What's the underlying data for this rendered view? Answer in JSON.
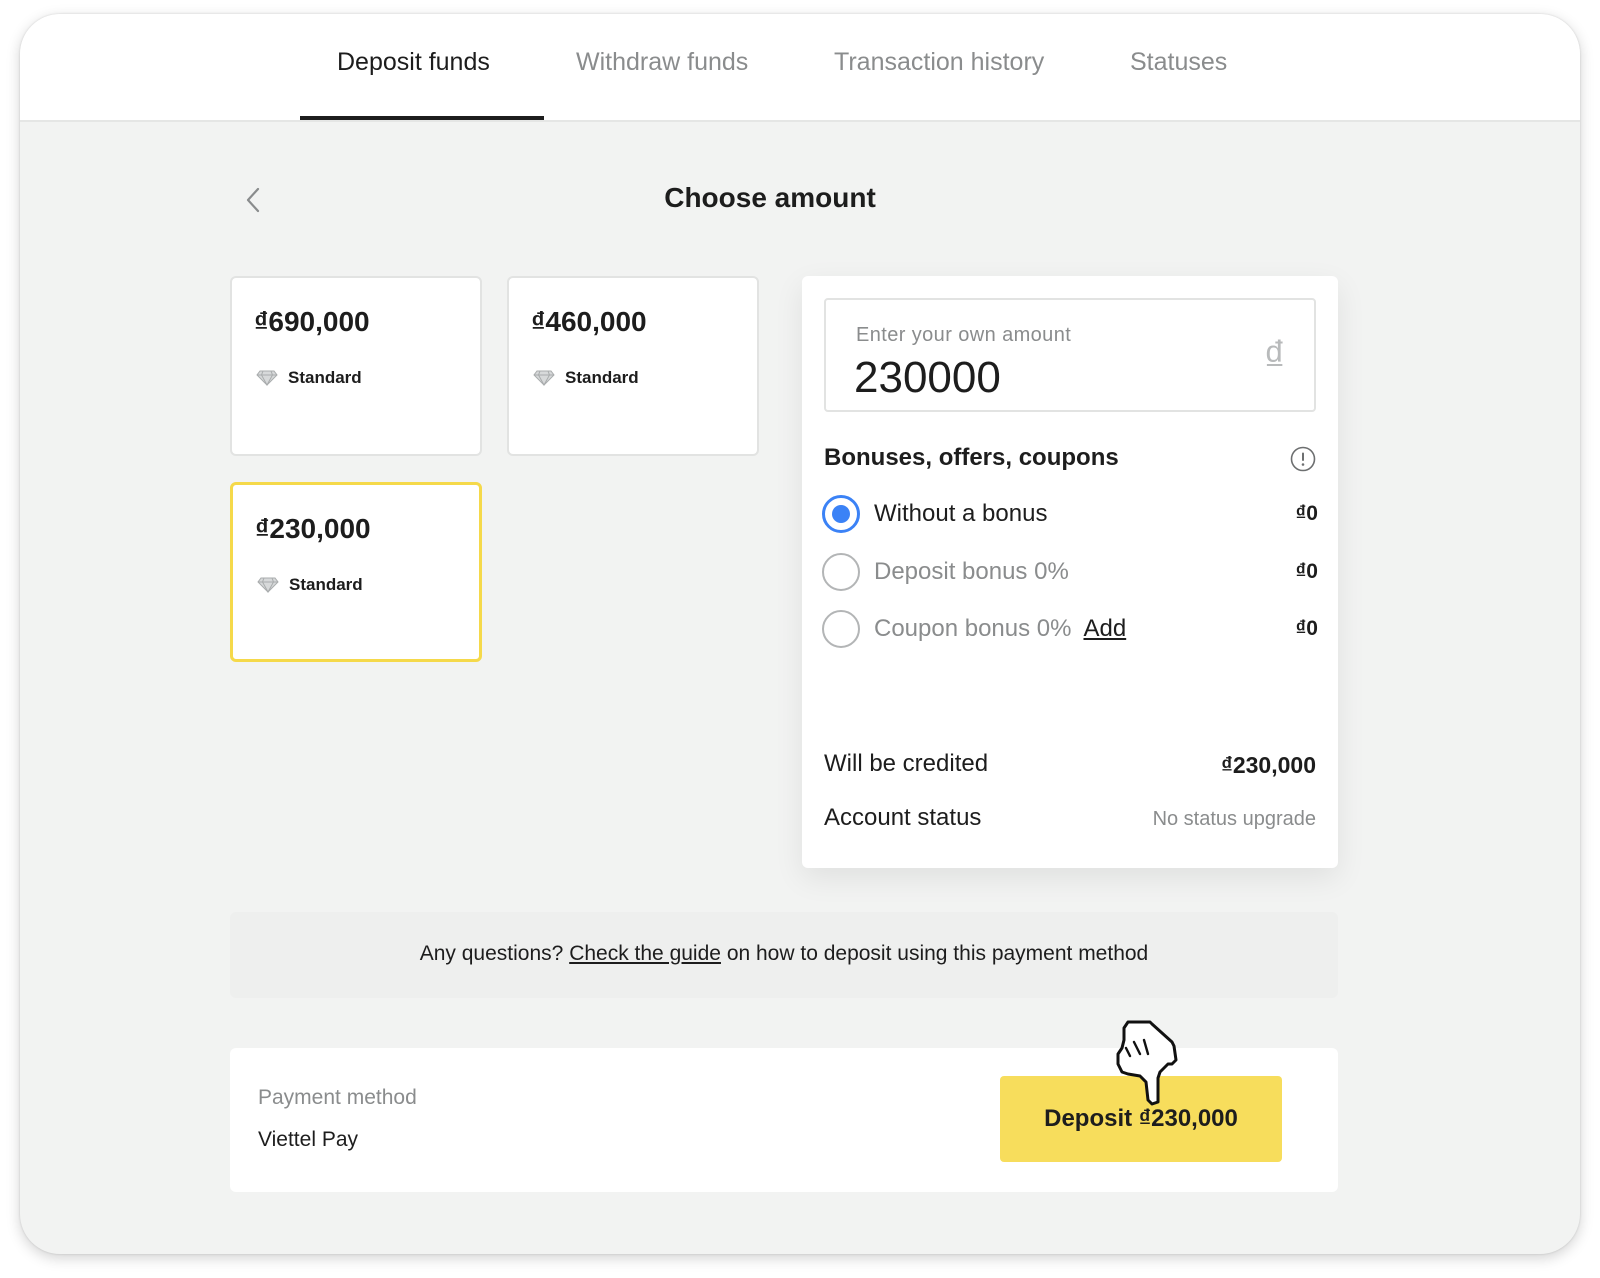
{
  "tabs": [
    {
      "label": "Deposit funds",
      "active": true
    },
    {
      "label": "Withdraw funds",
      "active": false
    },
    {
      "label": "Transaction history",
      "active": false
    },
    {
      "label": "Statuses",
      "active": false
    }
  ],
  "header": {
    "title": "Choose amount",
    "back_icon": "chevron-left-icon"
  },
  "amount_cards": [
    {
      "amount": "₫690,000",
      "tier": "Standard",
      "selected": false
    },
    {
      "amount": "₫460,000",
      "tier": "Standard",
      "selected": false
    },
    {
      "amount": "₫230,000",
      "tier": "Standard",
      "selected": true
    }
  ],
  "own_amount": {
    "label": "Enter your own amount",
    "value": "230000",
    "currency_symbol": "₫"
  },
  "bonuses": {
    "title": "Bonuses, offers, coupons",
    "info_icon": "info-icon",
    "options": [
      {
        "label": "Without a bonus",
        "value": "₫0",
        "selected": true
      },
      {
        "label": "Deposit bonus 0%",
        "value": "₫0",
        "selected": false
      },
      {
        "label": "Coupon bonus 0%",
        "value": "₫0",
        "selected": false,
        "link": "Add"
      }
    ]
  },
  "summary": {
    "credited_label": "Will be credited",
    "credited_value": "₫230,000",
    "status_label": "Account status",
    "status_value": "No status upgrade"
  },
  "guide": {
    "prefix": "Any questions?",
    "link": "Check the guide",
    "suffix": "on how to deposit using this payment method"
  },
  "payment": {
    "label": "Payment method",
    "method": "Viettel Pay",
    "button_label": "Deposit ₫230,000"
  },
  "colors": {
    "accent_yellow": "#f7dd5c",
    "selected_border": "#f5d94a",
    "radio_blue": "#3b82f6",
    "background": "#f2f3f2"
  }
}
